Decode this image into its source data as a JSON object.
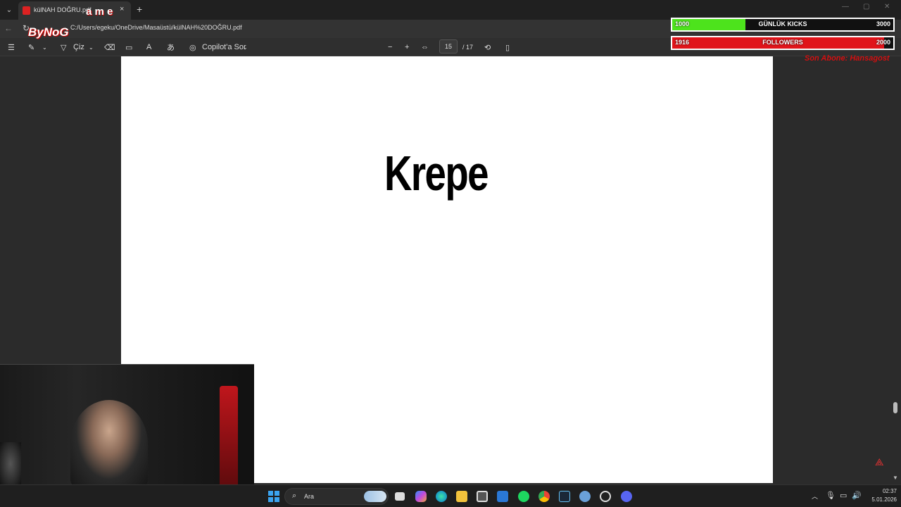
{
  "browser": {
    "tab_title": "külNAH DOĞRU.pdf",
    "tab_close": "×",
    "new_tab": "+",
    "url": "C:/Users/egeku/OneDrive/Masaüstü/külNAH%20DOĞRU.pdf"
  },
  "toolbar": {
    "draw_label": "Çiz",
    "copilot_label": "Copilot'a Sor",
    "zoom_out": "−",
    "zoom_in": "+",
    "current_page": "15",
    "total_pages": "/ 17"
  },
  "document": {
    "heading": "Krepe"
  },
  "taskbar": {
    "search_label": "Ara",
    "time": "02:37",
    "date": "5.01.2026"
  },
  "overlay": {
    "logo_text": "ByNoG",
    "logo_ame": "a m e",
    "goal_kicks": {
      "current": "1000",
      "label": "GÜNLÜK KICKS",
      "target": "3000",
      "progress": 0.33,
      "color": "#4de31c"
    },
    "goal_followers": {
      "current": "1916",
      "label": "FOLLOWERS",
      "target": "2000",
      "progress": 0.96,
      "color": "#e0141a"
    },
    "last_sub": "Son Abone: Hansagost"
  }
}
